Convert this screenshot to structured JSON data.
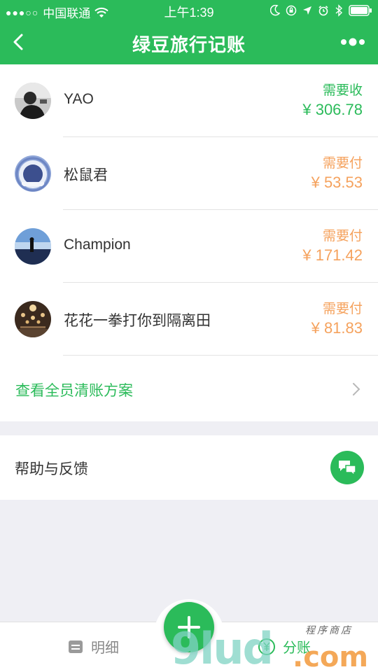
{
  "status_bar": {
    "signal": "●●●○○",
    "carrier": "中国联通",
    "time": "上午1:39"
  },
  "nav": {
    "title": "绿豆旅行记账",
    "back_icon": "chevron-left-icon",
    "more_icon": "more-dots-icon"
  },
  "members": [
    {
      "name": "YAO",
      "label": "需要收",
      "amount": "¥ 306.78",
      "status": "receive"
    },
    {
      "name": "松鼠君",
      "label": "需要付",
      "amount": "¥ 53.53",
      "status": "pay"
    },
    {
      "name": "Champion",
      "label": "需要付",
      "amount": "¥ 171.42",
      "status": "pay"
    },
    {
      "name": "花花一拳打你到隔离田",
      "label": "需要付",
      "amount": "¥ 81.83",
      "status": "pay"
    }
  ],
  "settle": {
    "label": "查看全员清账方案"
  },
  "help": {
    "label": "帮助与反馈",
    "icon": "chat-bubbles-icon"
  },
  "tabbar": {
    "detail_label": "明细",
    "split_label": "分账",
    "add_icon": "plus-icon"
  },
  "watermark": {
    "text_big": "9lud",
    "text_com": ".com",
    "text_small": "程序商店"
  },
  "colors": {
    "brand_green": "#2bbb5a",
    "pay_orange": "#f5a25d",
    "background": "#efeff4"
  }
}
